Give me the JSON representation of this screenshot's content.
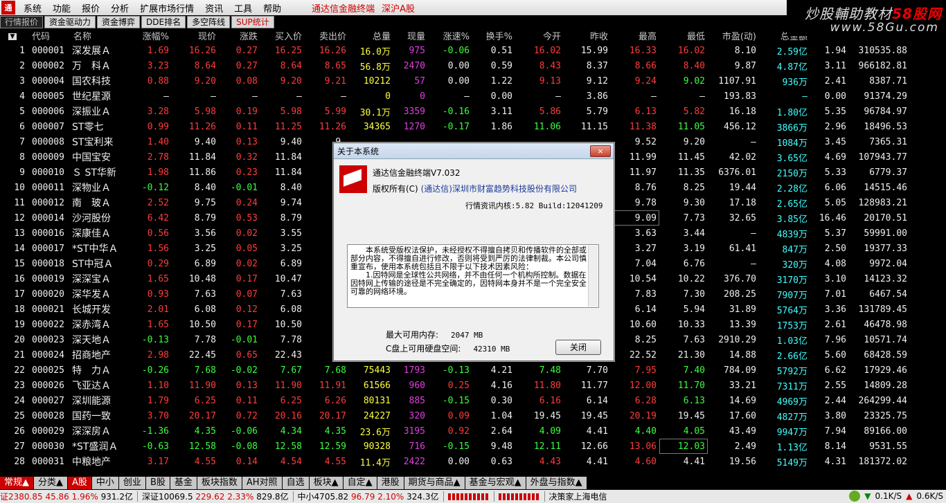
{
  "menu": {
    "items": [
      "系统",
      "功能",
      "报价",
      "分析",
      "扩展市场行情",
      "资讯",
      "工具",
      "帮助"
    ],
    "brand": "通达信金融终端",
    "market": "深沪A股"
  },
  "watermark": {
    "line1a": "炒股輔助教材",
    "line1b": "58股网",
    "line2": "www.58Gu.com"
  },
  "tabs": [
    "行情报价",
    "资金驱动力",
    "资金博弈",
    "DDE排名",
    "多空阵线",
    "SUP统计"
  ],
  "columns": [
    "",
    "代码",
    "名称",
    "涨幅%",
    "现价",
    "涨跌",
    "买入价",
    "卖出价",
    "总量",
    "现量",
    "涨速%",
    "换手%",
    "今开",
    "昨收",
    "最高",
    "最低",
    "市盈(动)",
    "总金额",
    "",
    ""
  ],
  "colors": {
    "up": "#ff3c3c",
    "down": "#3cff3c",
    "flat": "#f0f0f0",
    "vol": "#ffff40",
    "cur": "#e040e0",
    "amt": "#40ffff"
  },
  "rows": [
    {
      "i": "1",
      "code": "000001",
      "name": "深发展Ａ",
      "pct": "1.69",
      "price": "16.26",
      "chg": "0.27",
      "bid": "16.25",
      "ask": "16.26",
      "vol": "16.0万",
      "cur": "975",
      "spd": "-0.06",
      "turn": "0.51",
      "open": "16.02",
      "pre": "15.99",
      "high": "16.33",
      "low": "16.02",
      "pe": "8.10",
      "amt": "2.59亿",
      "x1": "1.94",
      "x2": "310535.88"
    },
    {
      "i": "2",
      "code": "000002",
      "name": "万　科Ａ",
      "pct": "3.23",
      "price": "8.64",
      "chg": "0.27",
      "bid": "8.64",
      "ask": "8.65",
      "vol": "56.8万",
      "cur": "2470",
      "spd": "0.00",
      "turn": "0.59",
      "open": "8.43",
      "pre": "8.37",
      "high": "8.66",
      "low": "8.40",
      "pe": "9.87",
      "amt": "4.87亿",
      "x1": "3.11",
      "x2": "966182.81"
    },
    {
      "i": "3",
      "code": "000004",
      "name": "国农科技",
      "pct": "0.88",
      "price": "9.20",
      "chg": "0.08",
      "bid": "9.20",
      "ask": "9.21",
      "vol": "10212",
      "cur": "57",
      "spd": "0.00",
      "turn": "1.22",
      "open": "9.13",
      "pre": "9.12",
      "high": "9.24",
      "low": "9.02",
      "pe": "1107.91",
      "amt": "936万",
      "x1": "2.41",
      "x2": "8387.71"
    },
    {
      "i": "4",
      "code": "000005",
      "name": "世纪星源",
      "pct": "–",
      "price": "–",
      "chg": "–",
      "bid": "–",
      "ask": "–",
      "vol": "0",
      "cur": "0",
      "spd": "–",
      "turn": "0.00",
      "open": "–",
      "pre": "3.86",
      "high": "–",
      "low": "–",
      "pe": "193.83",
      "amt": "–",
      "x1": "0.00",
      "x2": "91374.29"
    },
    {
      "i": "5",
      "code": "000006",
      "name": "深振业Ａ",
      "pct": "3.28",
      "price": "5.98",
      "chg": "0.19",
      "bid": "5.98",
      "ask": "5.99",
      "vol": "30.1万",
      "cur": "3359",
      "spd": "-0.16",
      "turn": "3.11",
      "open": "5.86",
      "pre": "5.79",
      "high": "6.13",
      "low": "5.82",
      "pe": "16.18",
      "amt": "1.80亿",
      "x1": "5.35",
      "x2": "96784.97"
    },
    {
      "i": "6",
      "code": "000007",
      "name": "ST零七",
      "pct": "0.99",
      "price": "11.26",
      "chg": "0.11",
      "bid": "11.25",
      "ask": "11.26",
      "vol": "34365",
      "cur": "1270",
      "spd": "-0.17",
      "turn": "1.86",
      "open": "11.06",
      "pre": "11.15",
      "high": "11.38",
      "low": "11.05",
      "pe": "456.12",
      "amt": "3866万",
      "x1": "2.96",
      "x2": "18496.53"
    },
    {
      "i": "7",
      "code": "000008",
      "name": "ST宝利来",
      "pct": "1.40",
      "price": "9.40",
      "chg": "0.13",
      "bid": "9.40",
      "ask": "9.",
      "vol": "",
      "cur": "",
      "spd": "",
      "turn": "",
      "open": "",
      "pre": "",
      "high": "9.52",
      "low": "9.20",
      "pe": "–",
      "amt": "1084万",
      "x1": "3.45",
      "x2": "7365.31"
    },
    {
      "i": "8",
      "code": "000009",
      "name": "中国宝安",
      "pct": "2.78",
      "price": "11.84",
      "chg": "0.32",
      "bid": "11.84",
      "ask": "11",
      "vol": "",
      "cur": "",
      "spd": "",
      "turn": "",
      "open": "",
      "pre": "",
      "high": "11.99",
      "low": "11.45",
      "pe": "42.02",
      "amt": "3.65亿",
      "x1": "4.69",
      "x2": "107943.77"
    },
    {
      "i": "9",
      "code": "000010",
      "name": "Ｓ ST华新",
      "pct": "1.98",
      "price": "11.86",
      "chg": "0.23",
      "bid": "11.84",
      "ask": "11",
      "vol": "",
      "cur": "",
      "spd": "",
      "turn": "",
      "open": "",
      "pre": "",
      "high": "11.97",
      "low": "11.35",
      "pe": "6376.01",
      "amt": "2150万",
      "x1": "5.33",
      "x2": "6779.37"
    },
    {
      "i": "10",
      "code": "000011",
      "name": "深物业Ａ",
      "pct": "-0.12",
      "price": "8.40",
      "chg": "-0.01",
      "bid": "8.40",
      "ask": "8.",
      "vol": "",
      "cur": "",
      "spd": "",
      "turn": "",
      "open": "",
      "pre": "",
      "high": "8.76",
      "low": "8.25",
      "pe": "19.44",
      "amt": "2.28亿",
      "x1": "6.06",
      "x2": "14515.46"
    },
    {
      "i": "11",
      "code": "000012",
      "name": "南　玻Ａ",
      "pct": "2.52",
      "price": "9.75",
      "chg": "0.24",
      "bid": "9.74",
      "ask": "9.",
      "vol": "",
      "cur": "",
      "spd": "",
      "turn": "",
      "open": "",
      "pre": "",
      "high": "9.78",
      "low": "9.30",
      "pe": "17.18",
      "amt": "2.65亿",
      "x1": "5.05",
      "x2": "128983.21"
    },
    {
      "i": "12",
      "code": "000014",
      "name": "沙河股份",
      "pct": "6.42",
      "price": "8.79",
      "chg": "0.53",
      "bid": "8.79",
      "ask": "8.",
      "vol": "",
      "cur": "",
      "spd": "",
      "turn": "",
      "open": "",
      "pre": "",
      "high": "9.09",
      "low": "7.73",
      "pe": "32.65",
      "amt": "3.85亿",
      "x1": "16.46",
      "x2": "20170.51"
    },
    {
      "i": "13",
      "code": "000016",
      "name": "深康佳Ａ",
      "pct": "0.56",
      "price": "3.56",
      "chg": "0.02",
      "bid": "3.55",
      "ask": "3.",
      "vol": "",
      "cur": "",
      "spd": "",
      "turn": "",
      "open": "",
      "pre": "",
      "high": "3.63",
      "low": "3.44",
      "pe": "–",
      "amt": "4839万",
      "x1": "5.37",
      "x2": "59991.00"
    },
    {
      "i": "14",
      "code": "000017",
      "name": "*ST中华Ａ",
      "pct": "1.56",
      "price": "3.25",
      "chg": "0.05",
      "bid": "3.25",
      "ask": "3.",
      "vol": "",
      "cur": "",
      "spd": "",
      "turn": "",
      "open": "",
      "pre": "",
      "high": "3.27",
      "low": "3.19",
      "pe": "61.41",
      "amt": "847万",
      "x1": "2.50",
      "x2": "19377.33"
    },
    {
      "i": "15",
      "code": "000018",
      "name": "ST中冠Ａ",
      "pct": "0.29",
      "price": "6.89",
      "chg": "0.02",
      "bid": "6.89",
      "ask": "6.",
      "vol": "",
      "cur": "",
      "spd": "",
      "turn": "",
      "open": "",
      "pre": "",
      "high": "7.04",
      "low": "6.76",
      "pe": "–",
      "amt": "320万",
      "x1": "4.08",
      "x2": "9972.04"
    },
    {
      "i": "16",
      "code": "000019",
      "name": "深深宝Ａ",
      "pct": "1.65",
      "price": "10.48",
      "chg": "0.17",
      "bid": "10.47",
      "ask": "10",
      "vol": "",
      "cur": "",
      "spd": "",
      "turn": "",
      "open": "",
      "pre": "",
      "high": "10.54",
      "low": "10.22",
      "pe": "376.70",
      "amt": "3170万",
      "x1": "3.10",
      "x2": "14123.32"
    },
    {
      "i": "17",
      "code": "000020",
      "name": "深华发Ａ",
      "pct": "0.93",
      "price": "7.63",
      "chg": "0.07",
      "bid": "7.63",
      "ask": "7.",
      "vol": "",
      "cur": "",
      "spd": "",
      "turn": "",
      "open": "",
      "pre": "",
      "high": "7.83",
      "low": "7.30",
      "pe": "208.25",
      "amt": "7907万",
      "x1": "7.01",
      "x2": "6467.54"
    },
    {
      "i": "18",
      "code": "000021",
      "name": "长城开发",
      "pct": "2.01",
      "price": "6.08",
      "chg": "0.12",
      "bid": "6.08",
      "ask": "6.",
      "vol": "",
      "cur": "",
      "spd": "",
      "turn": "",
      "open": "",
      "pre": "",
      "high": "6.14",
      "low": "5.94",
      "pe": "31.89",
      "amt": "5764万",
      "x1": "3.36",
      "x2": "131789.45"
    },
    {
      "i": "19",
      "code": "000022",
      "name": "深赤湾Ａ",
      "pct": "1.65",
      "price": "10.50",
      "chg": "0.17",
      "bid": "10.50",
      "ask": "10",
      "vol": "",
      "cur": "",
      "spd": "",
      "turn": "",
      "open": "",
      "pre": "",
      "high": "10.60",
      "low": "10.33",
      "pe": "13.39",
      "amt": "1753万",
      "x1": "2.61",
      "x2": "46478.98"
    },
    {
      "i": "20",
      "code": "000023",
      "name": "深天地Ａ",
      "pct": "-0.13",
      "price": "7.78",
      "chg": "-0.01",
      "bid": "7.78",
      "ask": "7.",
      "vol": "",
      "cur": "",
      "spd": "",
      "turn": "",
      "open": "",
      "pre": "",
      "high": "8.25",
      "low": "7.63",
      "pe": "2910.29",
      "amt": "1.03亿",
      "x1": "7.96",
      "x2": "10571.74"
    },
    {
      "i": "21",
      "code": "000024",
      "name": "招商地产",
      "pct": "2.98",
      "price": "22.45",
      "chg": "0.65",
      "bid": "22.43",
      "ask": "22",
      "vol": "",
      "cur": "",
      "spd": "",
      "turn": "",
      "open": "",
      "pre": "",
      "high": "22.52",
      "low": "21.30",
      "pe": "14.88",
      "amt": "2.66亿",
      "x1": "5.60",
      "x2": "68428.59"
    },
    {
      "i": "22",
      "code": "000025",
      "name": "特　力Ａ",
      "pct": "-0.26",
      "price": "7.68",
      "chg": "-0.02",
      "bid": "7.67",
      "ask": "7.68",
      "vol": "75443",
      "cur": "1793",
      "spd": "-0.13",
      "turn": "4.21",
      "open": "7.48",
      "pre": "7.70",
      "high": "7.95",
      "low": "7.40",
      "pe": "784.09",
      "amt": "5792万",
      "x1": "6.62",
      "x2": "17929.46"
    },
    {
      "i": "23",
      "code": "000026",
      "name": "飞亚达Ａ",
      "pct": "1.10",
      "price": "11.90",
      "chg": "0.13",
      "bid": "11.90",
      "ask": "11.91",
      "vol": "61566",
      "cur": "960",
      "spd": "0.25",
      "turn": "4.16",
      "open": "11.80",
      "pre": "11.77",
      "high": "12.00",
      "low": "11.70",
      "pe": "33.21",
      "amt": "7311万",
      "x1": "2.55",
      "x2": "14809.28"
    },
    {
      "i": "24",
      "code": "000027",
      "name": "深圳能源",
      "pct": "1.79",
      "price": "6.25",
      "chg": "0.11",
      "bid": "6.25",
      "ask": "6.26",
      "vol": "80131",
      "cur": "885",
      "spd": "-0.15",
      "turn": "0.30",
      "open": "6.16",
      "pre": "6.14",
      "high": "6.28",
      "low": "6.13",
      "pe": "14.69",
      "amt": "4969万",
      "x1": "2.44",
      "x2": "264299.44"
    },
    {
      "i": "25",
      "code": "000028",
      "name": "国药一致",
      "pct": "3.70",
      "price": "20.17",
      "chg": "0.72",
      "bid": "20.16",
      "ask": "20.17",
      "vol": "24227",
      "cur": "320",
      "spd": "0.09",
      "turn": "1.04",
      "open": "19.45",
      "pre": "19.45",
      "high": "20.19",
      "low": "19.45",
      "pe": "17.60",
      "amt": "4827万",
      "x1": "3.80",
      "x2": "23325.75"
    },
    {
      "i": "26",
      "code": "000029",
      "name": "深深房Ａ",
      "pct": "-1.36",
      "price": "4.35",
      "chg": "-0.06",
      "bid": "4.34",
      "ask": "4.35",
      "vol": "23.6万",
      "cur": "3195",
      "spd": "0.92",
      "turn": "2.64",
      "open": "4.09",
      "pre": "4.41",
      "high": "4.40",
      "low": "4.05",
      "pe": "43.49",
      "amt": "9947万",
      "x1": "7.94",
      "x2": "89166.00"
    },
    {
      "i": "27",
      "code": "000030",
      "name": "*ST盛润Ａ",
      "pct": "-0.63",
      "price": "12.58",
      "chg": "-0.08",
      "bid": "12.58",
      "ask": "12.59",
      "vol": "90328",
      "cur": "716",
      "spd": "-0.15",
      "turn": "9.48",
      "open": "12.11",
      "pre": "12.66",
      "high": "13.06",
      "low": "12.03",
      "pe": "2.49",
      "amt": "1.13亿",
      "x1": "8.14",
      "x2": "9531.55"
    },
    {
      "i": "28",
      "code": "000031",
      "name": "中粮地产",
      "pct": "3.17",
      "price": "4.55",
      "chg": "0.14",
      "bid": "4.54",
      "ask": "4.55",
      "vol": "11.4万",
      "cur": "2422",
      "spd": "0.00",
      "turn": "0.63",
      "open": "4.43",
      "pre": "4.41",
      "high": "4.60",
      "low": "4.41",
      "pe": "19.56",
      "amt": "5149万",
      "x1": "4.31",
      "x2": "181372.02"
    }
  ],
  "dialog": {
    "title": "关于本系统",
    "close": "×",
    "version": "通达信金融终端V7.032",
    "copyright_label": "版权所有(C)",
    "company": "(通达信)深圳市财富趋势科技股份有限公司",
    "build": "行情资讯内核:5.82 Build:12041209",
    "notice1": "本系统受版权法保护，未经授权不得擅自拷贝和传播软件的全部或部分内容，不得擅自进行修改，否则将受到严厉的法律制裁。本公司慎重宣布，使用本系统包括且不限于以下技术因素风险：",
    "notice2": "1.因特网是全球性公共网络，并不由任何一个机构所控制。数据在因特网上传输的途径是不完全确定的，因特网本身并不是一个完全安全可靠的网络环境。",
    "mem_label": "最大可用内存:",
    "mem_val": "2047 MB",
    "disk_label": "C盘上可用硬盘空间:",
    "disk_val": "42310 MB",
    "ok": "关闭"
  },
  "bottom_tabs": [
    "常规▲",
    "分类▲",
    "A股",
    "中小",
    "创业",
    "B股",
    "基金",
    "板块指数",
    "AH对照",
    "自选",
    "板块▲",
    "自定▲",
    "港股",
    "期货与商品▲",
    "基金与宏观▲",
    "外盘与指数▲"
  ],
  "status": {
    "sh": "证2380.85",
    "sh_chg": "45.86",
    "sh_pct": "1.96%",
    "sh_amt": "931.2亿",
    "sz": "深证10069.5",
    "sz_chg": "229.62",
    "sz_pct": "2.33%",
    "sz_amt": "829.8亿",
    "zx": "中小4705.82",
    "zx_chg": "96.79",
    "zx_pct": "2.10%",
    "zx_amt": "324.3亿",
    "news": "决策家上海电信",
    "down": "0.1K/S",
    "up": "0.6K/S"
  }
}
